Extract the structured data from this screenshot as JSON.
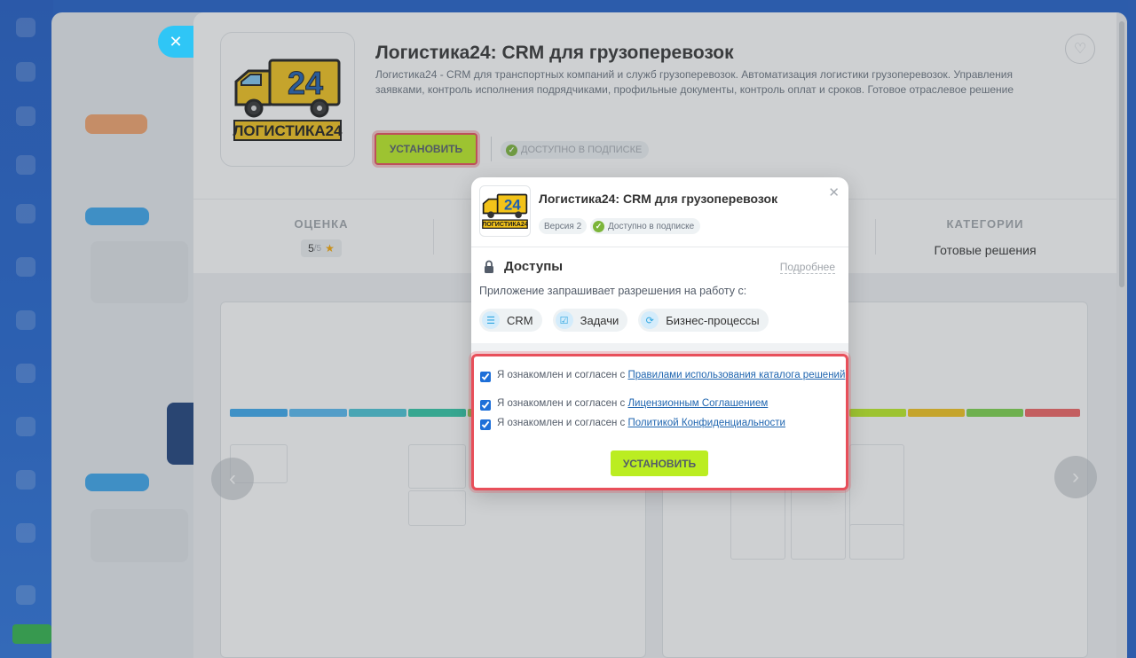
{
  "app": {
    "title": "Логистика24: CRM для грузоперевозок",
    "description": "Логистика24 - CRM для транспортных компаний и служб грузоперевозок. Автоматизация логистики грузоперевозок. Управления заявками, контроль исполнения подрядчиками, профильные документы, контроль оплат и сроков. Готовое отраслевое решение для...",
    "logo_number": "24",
    "logo_text": "ЛОГИСТИКА24",
    "install_label": "УСТАНОВИТЬ",
    "subscription_label": "ДОСТУПНО В ПОДПИСКЕ",
    "close_icon": "✕",
    "heart_icon": "♡"
  },
  "stats": {
    "rating_title": "ОЦЕНКА",
    "rating_value": "5",
    "rating_max": "/5",
    "categories_title": "КАТЕГОРИИ",
    "categories_value": "Готовые решения"
  },
  "modal": {
    "title": "Логистика24: CRM для грузоперевозок",
    "version": "Версия 2",
    "subscription": "Доступно в подписке",
    "access_title": "Доступы",
    "more_link": "Подробнее",
    "request_text": "Приложение запрашивает разрешения на работу с:",
    "scopes": [
      {
        "label": "CRM",
        "icon": "crm-filter-icon"
      },
      {
        "label": "Задачи",
        "icon": "tasks-check-icon"
      },
      {
        "label": "Бизнес-процессы",
        "icon": "bizproc-cycle-icon"
      }
    ],
    "agreements": [
      {
        "prefix": "Я ознакомлен и согласен с ",
        "link": "Правилами использования каталога решений",
        "checked": true
      },
      {
        "prefix": "Я ознакомлен и согласен с ",
        "link": "Лицензионным Соглашением",
        "checked": true
      },
      {
        "prefix": "Я ознакомлен и согласен с ",
        "link": "Политикой Конфиденциальности",
        "checked": true
      }
    ],
    "install_label": "УСТАНОВИТЬ",
    "close_icon": "✕"
  },
  "colors": {
    "accent_green": "#bbed21",
    "highlight_red": "#e84f5a",
    "link_blue": "#2066b0",
    "slider_close_blue": "#2fc6f6"
  }
}
